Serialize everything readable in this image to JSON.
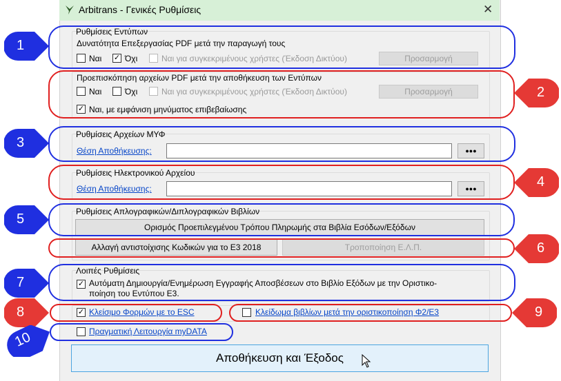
{
  "window": {
    "title": "Arbitrans - Γενικές Ρυθμίσεις",
    "close": "✕"
  },
  "print_settings": {
    "group_label": "Ρυθμίσεις Εντύπων",
    "pdf_edit_label": "Δυνατότητα Επεξεργασίας PDF μετά την παραγωγή τους",
    "yes": "Ναι",
    "yes_checked": false,
    "no": "Όχι",
    "no_checked": true,
    "specific_users": "Ναι για συγκεκριμένους χρήστες (Έκδοση Δικτύου)",
    "customize": "Προσαρμογή"
  },
  "pdf_preview": {
    "label": "Προεπισκόπηση αρχείων PDF μετά την αποθήκευση των Εντύπων",
    "yes": "Ναι",
    "yes_checked": false,
    "no": "Όχι",
    "no_checked": false,
    "specific_users": "Ναι για συγκεκριμένους χρήστες (Έκδοση Δικτύου)",
    "customize": "Προσαρμογή",
    "confirm_message": "Ναι, με εμφάνιση μηνύματος επιβεβαίωσης",
    "confirm_checked": true
  },
  "myf_files": {
    "group_label": "Ρυθμίσεις Αρχείων ΜΥΦ",
    "location_label": "Θέση Αποθήκευσης:",
    "location_value": "",
    "browse": "●●●"
  },
  "electronic_archive": {
    "group_label": "Ρυθμίσεις Ηλεκτρονικού Αρχείου",
    "location_label": "Θέση Αποθήκευσης:",
    "location_value": "",
    "browse": "●●●"
  },
  "books": {
    "group_label": "Ρυθμίσεις Απλογραφικών/Διπλογραφικών Βιβλίων",
    "default_payment_button": "Ορισμός Προεπιλεγμένου Τρόπου Πληρωμής στα Βιβλία Εσόδων/Εξόδων",
    "e3_mapping_button": "Αλλαγή αντιστοίχισης Κωδικών για το Ε3 2018",
    "elp_button": "Τροποποίηση Ε.Λ.Π."
  },
  "other": {
    "group_label": "Λοιπές Ρυθμίσεις",
    "depreciation_line1": "Αυτόματη Δημιουργία/Ενημέρωση Εγγραφής Αποσβέσεων στο Βιβλίο Εξόδων με την Οριστικο-",
    "depreciation_line2": "ποίηση του Εντύπου Ε3.",
    "depreciation_checked": true,
    "esc_close": "Κλείσιμο Φορμών με το ESC",
    "esc_checked": true,
    "lock_books": "Κλείδωμα βιβλίων μετά την οριστικοποίηση Φ2/Ε3",
    "lock_checked": false,
    "mydata": "Πραγματική Λειτουργία myDATA",
    "mydata_checked": false
  },
  "save_button": "Αποθήκευση και Έξοδος",
  "markers": [
    "1",
    "2",
    "3",
    "4",
    "5",
    "6",
    "7",
    "8",
    "9",
    "10"
  ],
  "colors": {
    "titlebar": "#d7f0d7",
    "blue_marker": "#1f2fe0",
    "red_marker": "#e53935",
    "link": "#0645c8"
  }
}
